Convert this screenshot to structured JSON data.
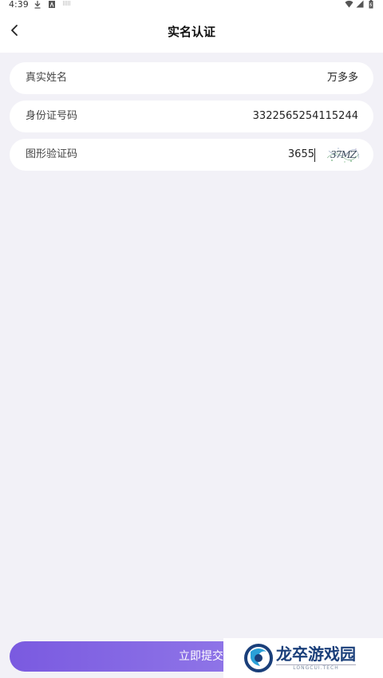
{
  "status_bar": {
    "time": "4:39",
    "left_icons": [
      "download-icon",
      "a-icon",
      "qr-icon"
    ],
    "right_icons": [
      "wifi-icon",
      "signal-icon",
      "battery-icon"
    ]
  },
  "header": {
    "title": "实名认证",
    "back_icon": "chevron-left-icon"
  },
  "form": {
    "name": {
      "label": "真实姓名",
      "value": "万多多"
    },
    "id_number": {
      "label": "身份证号码",
      "value": "3322565254115244"
    },
    "captcha": {
      "label": "图形验证码",
      "value": "3655",
      "image_text": "37MZ"
    }
  },
  "submit": {
    "label": "立即提交"
  },
  "watermark": {
    "cn": "龙卒游戏园",
    "en": "LONGCUI.TECH"
  },
  "colors": {
    "background": "#f2f1f7",
    "accent_start": "#7a5ae0",
    "accent_end": "#9c86ec"
  }
}
